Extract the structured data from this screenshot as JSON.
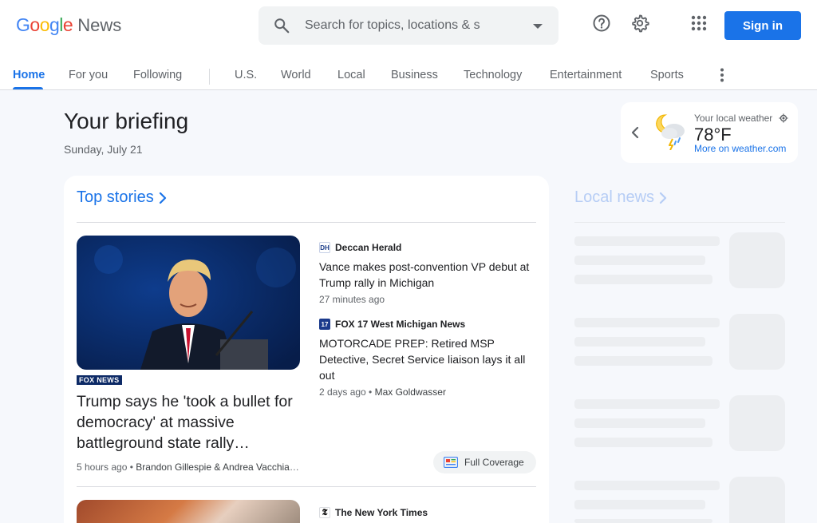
{
  "header": {
    "logo_letters": [
      "G",
      "o",
      "o",
      "g",
      "l",
      "e"
    ],
    "logo_colors": [
      "#4285f4",
      "#ea4335",
      "#fbbc05",
      "#4285f4",
      "#34a853",
      "#ea4335"
    ],
    "logo_suffix": "News",
    "search_placeholder": "Search for topics, locations & s",
    "sign_in": "Sign in",
    "icons": [
      "search-icon",
      "help-icon",
      "settings-icon",
      "apps-icon"
    ]
  },
  "tabs": [
    "Home",
    "For you",
    "Following",
    "U.S.",
    "World",
    "Local",
    "Business",
    "Technology",
    "Entertainment",
    "Sports"
  ],
  "active_tab": "Home",
  "briefing": {
    "title": "Your briefing",
    "date": "Sunday, July 21"
  },
  "weather": {
    "label": "Your local weather",
    "temp": "78°F",
    "link": "More on weather.com"
  },
  "top_stories": {
    "heading": "Top stories",
    "main": {
      "source": "FOX NEWS",
      "title": "Trump says he 'took a bullet for democracy' at massive battleground state rally…",
      "time": "5 hours ago",
      "author": "Brandon Gillespie & Andrea Vacchiano"
    },
    "side": [
      {
        "source": "Deccan Herald",
        "fav": "DH",
        "title": "Vance makes post-convention VP debut at Trump rally in Michigan",
        "time": "27 minutes ago",
        "author": ""
      },
      {
        "source": "FOX 17 West Michigan News",
        "fav": "17",
        "title": "MOTORCADE PREP: Retired MSP Detective, Secret Service liaison lays it all out",
        "time": "2 days ago",
        "author": "Max Goldwasser"
      }
    ],
    "full_coverage": "Full Coverage",
    "next_source": "The New York Times"
  },
  "local_news": {
    "heading": "Local news"
  }
}
